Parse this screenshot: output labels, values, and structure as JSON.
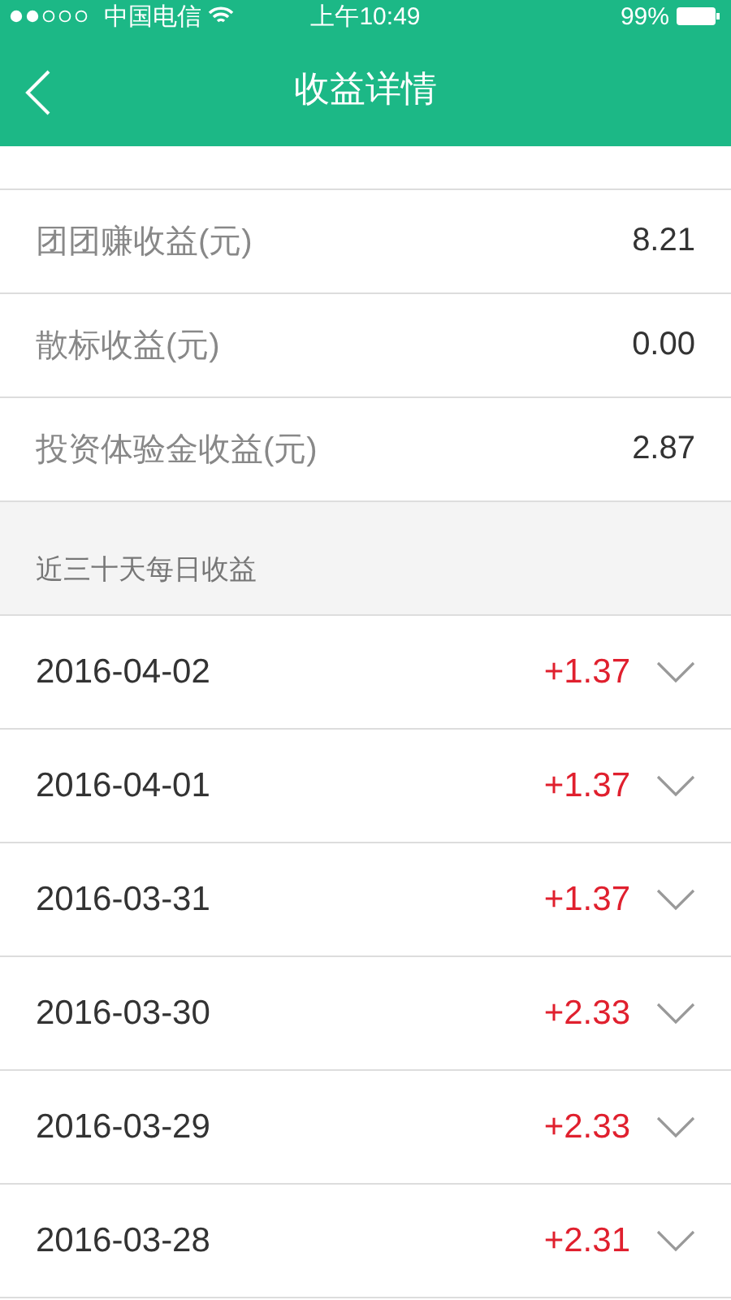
{
  "status_bar": {
    "carrier": "中国电信",
    "time": "上午10:49",
    "battery": "99%"
  },
  "nav": {
    "title": "收益详情"
  },
  "summary": [
    {
      "label": "团团赚收益(元)",
      "value": "8.21"
    },
    {
      "label": "散标收益(元)",
      "value": "0.00"
    },
    {
      "label": "投资体验金收益(元)",
      "value": "2.87"
    }
  ],
  "daily": {
    "heading": "近三十天每日收益",
    "rows": [
      {
        "date": "2016-04-02",
        "amount": "+1.37",
        "expanded": false
      },
      {
        "date": "2016-04-01",
        "amount": "+1.37",
        "expanded": false
      },
      {
        "date": "2016-03-31",
        "amount": "+1.37",
        "expanded": false
      },
      {
        "date": "2016-03-30",
        "amount": "+2.33",
        "expanded": false
      },
      {
        "date": "2016-03-29",
        "amount": "+2.33",
        "expanded": false
      },
      {
        "date": "2016-03-28",
        "amount": "+2.31",
        "expanded": false
      }
    ]
  }
}
